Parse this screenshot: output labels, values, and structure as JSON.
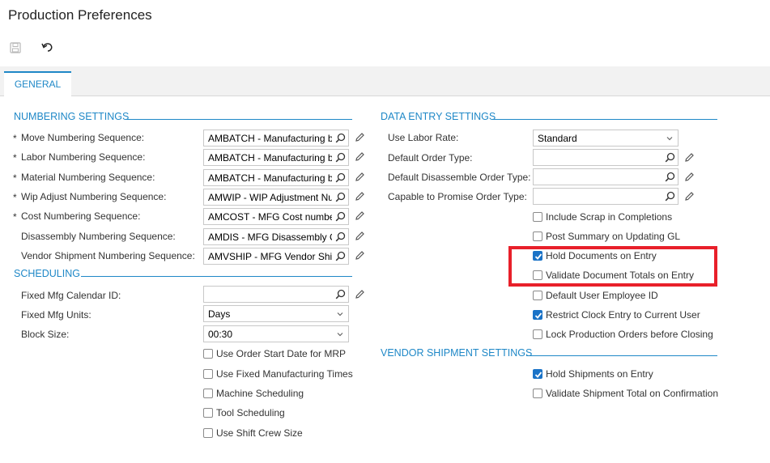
{
  "page": {
    "title": "Production Preferences"
  },
  "toolbar": {
    "save_icon": "save-icon",
    "undo_icon": "undo-icon"
  },
  "tabs": [
    {
      "label": "GENERAL",
      "active": true
    }
  ],
  "numbering": {
    "title": "NUMBERING SETTINGS",
    "rows": [
      {
        "required": "*",
        "label": "Move Numbering Sequence:",
        "value": "AMBATCH - Manufacturing batch"
      },
      {
        "required": "*",
        "label": "Labor Numbering Sequence:",
        "value": "AMBATCH - Manufacturing batch"
      },
      {
        "required": "*",
        "label": "Material Numbering Sequence:",
        "value": "AMBATCH - Manufacturing batch"
      },
      {
        "required": "*",
        "label": "Wip Adjust Numbering Sequence:",
        "value": "AMWIP - WIP Adjustment Number"
      },
      {
        "required": "*",
        "label": "Cost Numbering Sequence:",
        "value": "AMCOST - MFG Cost number"
      },
      {
        "required": "",
        "label": "Disassembly Numbering Sequence:",
        "value": "AMDIS - MFG Disassembly Order"
      },
      {
        "required": "",
        "label": "Vendor Shipment Numbering Sequence:",
        "value": "AMVSHIP - MFG Vendor Shipment"
      }
    ]
  },
  "scheduling": {
    "title": "SCHEDULING",
    "calendar": {
      "label": "Fixed Mfg Calendar ID:",
      "value": ""
    },
    "units": {
      "label": "Fixed Mfg Units:",
      "value": "Days"
    },
    "block": {
      "label": "Block Size:",
      "value": "00:30"
    },
    "checkboxes": [
      {
        "label": "Use Order Start Date for MRP",
        "checked": false
      },
      {
        "label": "Use Fixed Manufacturing Times",
        "checked": false
      },
      {
        "label": "Machine Scheduling",
        "checked": false
      },
      {
        "label": "Tool Scheduling",
        "checked": false
      },
      {
        "label": "Use Shift Crew Size",
        "checked": false
      }
    ]
  },
  "data_entry": {
    "title": "DATA ENTRY SETTINGS",
    "labor_rate": {
      "label": "Use Labor Rate:",
      "value": "Standard"
    },
    "order_type": {
      "label": "Default Order Type:",
      "value": ""
    },
    "disassemble_type": {
      "label": "Default Disassemble Order Type:",
      "value": ""
    },
    "ctp_type": {
      "label": "Capable to Promise Order Type:",
      "value": ""
    },
    "checkboxes": [
      {
        "label": "Include Scrap in Completions",
        "checked": false
      },
      {
        "label": "Post Summary on Updating GL",
        "checked": false
      },
      {
        "label": "Hold Documents on Entry",
        "checked": true
      },
      {
        "label": "Validate Document Totals on Entry",
        "checked": false
      },
      {
        "label": "Default User Employee ID",
        "checked": false
      },
      {
        "label": "Restrict Clock Entry to Current User",
        "checked": true
      },
      {
        "label": "Lock Production Orders before Closing",
        "checked": false
      }
    ]
  },
  "vendor_shipment": {
    "title": "VENDOR SHIPMENT SETTINGS",
    "checkboxes": [
      {
        "label": "Hold Shipments on Entry",
        "checked": true
      },
      {
        "label": "Validate Shipment Total on Confirmation",
        "checked": false
      }
    ]
  },
  "colors": {
    "accent": "#1f88c7",
    "highlight": "#e8202a",
    "checkbox": "#1a73c7"
  }
}
